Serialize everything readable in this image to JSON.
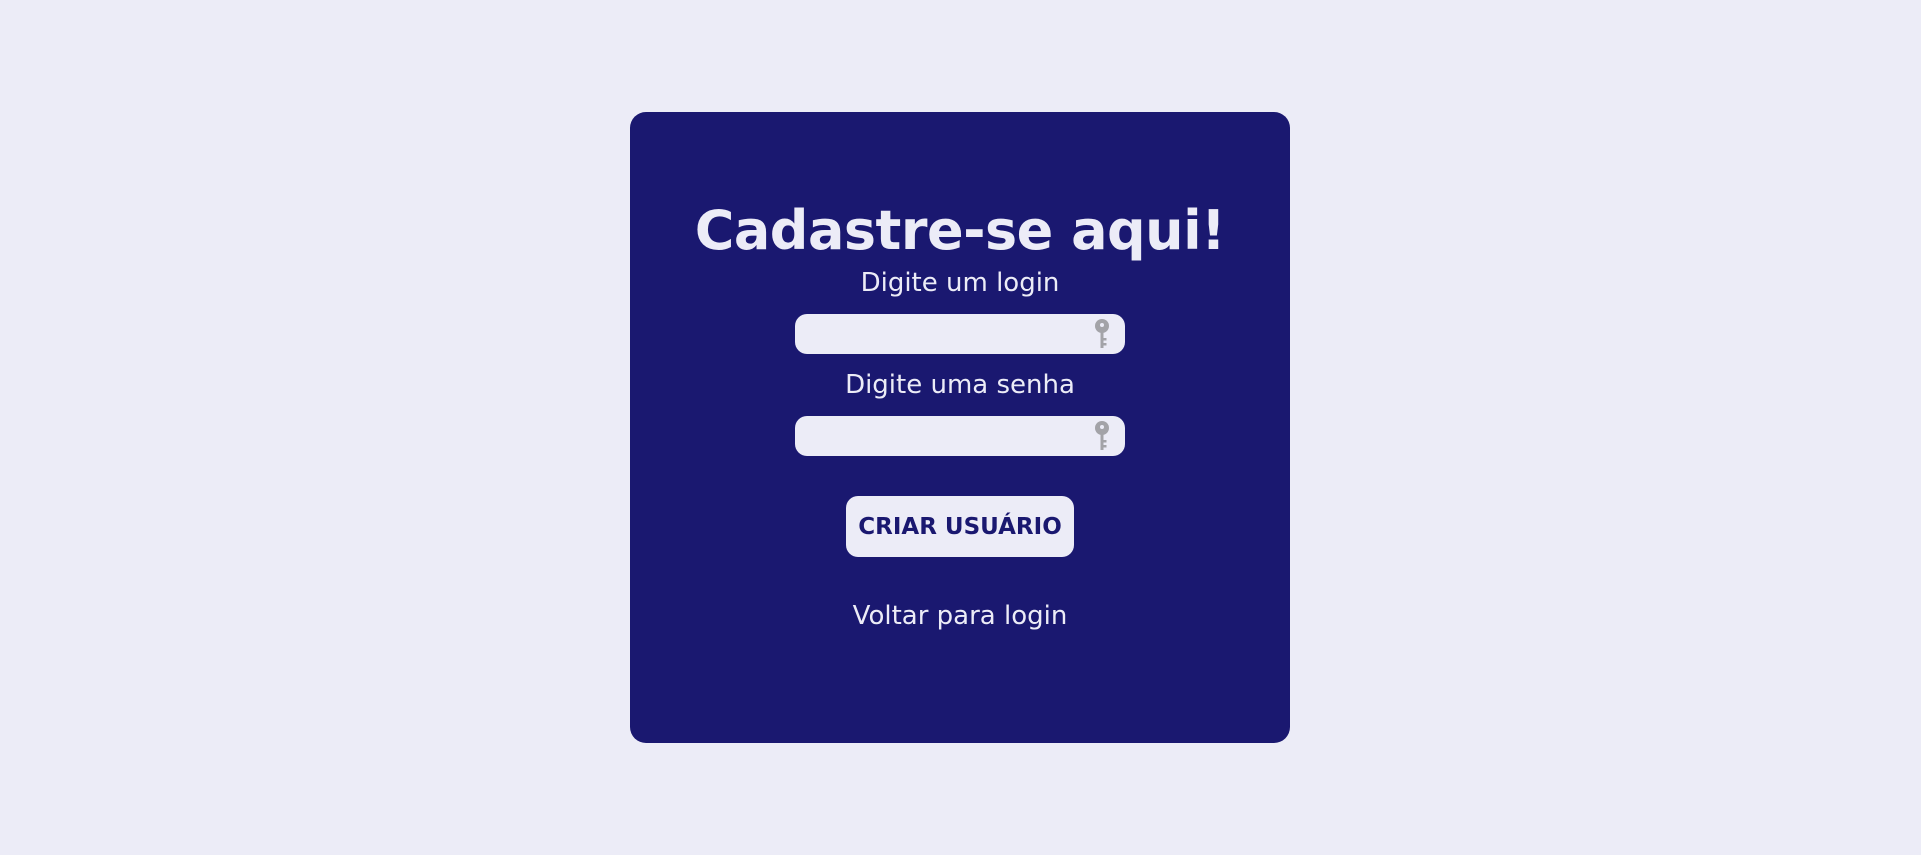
{
  "page": {
    "background_color": "#ececf7",
    "card_color": "#1a1870"
  },
  "form": {
    "title": "Cadastre-se aqui!",
    "login": {
      "label": "Digite um login",
      "value": "",
      "icon": "key-icon"
    },
    "password": {
      "label": "Digite uma senha",
      "value": "",
      "icon": "key-icon"
    },
    "submit_label": "CRIAR USUÁRIO",
    "back_link_label": "Voltar para login"
  }
}
